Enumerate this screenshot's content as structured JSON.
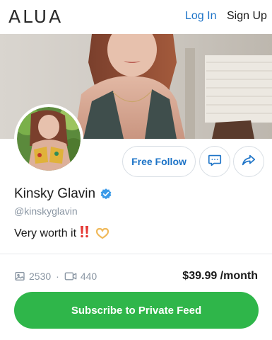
{
  "header": {
    "logo": "ALUA",
    "login_label": "Log In",
    "signup_label": "Sign Up"
  },
  "profile": {
    "name": "Kinsky Glavin",
    "handle": "@kinskyglavin",
    "bio": "Very worth it",
    "bio_emoji": [
      "double-exclamation-emoji",
      "heart-hands-emoji"
    ],
    "verified_icon": "verified-badge-icon"
  },
  "actions": {
    "follow_label": "Free Follow",
    "message_icon": "chat-bubble-icon",
    "share_icon": "share-arrow-icon"
  },
  "stats": {
    "photos_count": "2530",
    "videos_count": "440",
    "separator": "·",
    "price": "$39.99 /month"
  },
  "subscribe": {
    "label": "Subscribe to Private Feed"
  },
  "colors": {
    "accent_blue": "#1c73c7",
    "subscribe_green": "#2fb64a",
    "muted_text": "#8a96a3"
  }
}
